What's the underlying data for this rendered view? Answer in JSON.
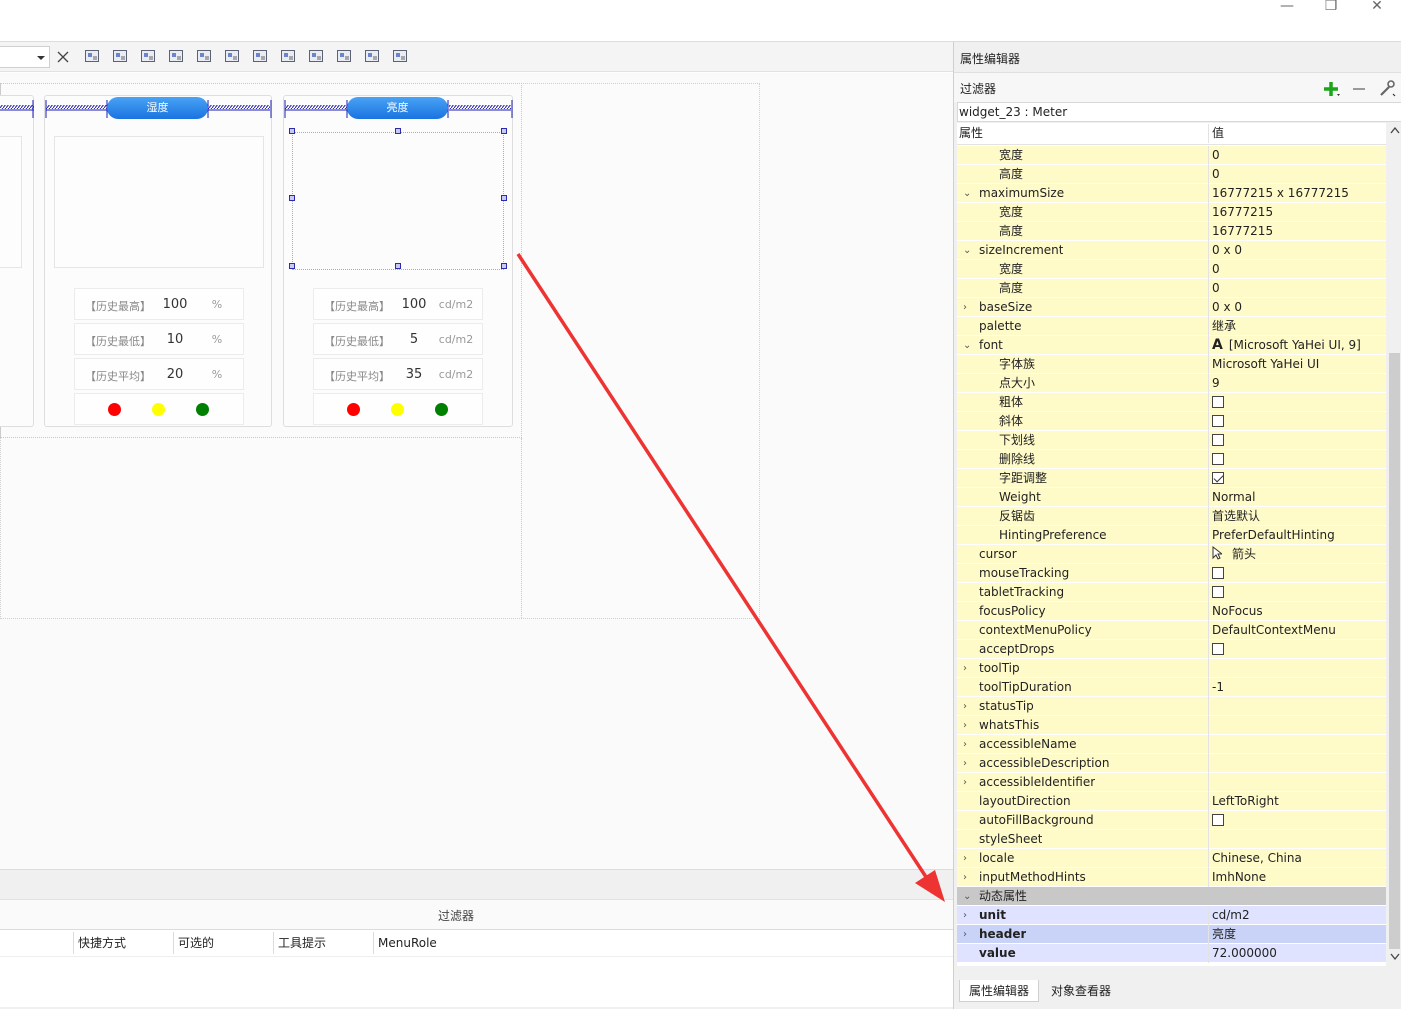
{
  "window": {
    "minimize": "—",
    "restore": "❐",
    "close": "✕"
  },
  "toolbar": {
    "icons": [
      "dropdown-arrow-icon",
      "close-icon",
      "edit-widgets-icon",
      "edit-signals-icon",
      "edit-buddies-icon",
      "edit-tab-order-icon",
      "layout-horizontal-icon",
      "layout-vertical-icon",
      "layout-horizontal-splitter-icon",
      "layout-vertical-splitter-icon",
      "layout-form-icon",
      "layout-grid-icon",
      "break-layout-icon",
      "adjust-size-icon"
    ]
  },
  "canvas": {
    "panels": [
      {
        "header": "湿度",
        "stats": [
          {
            "label": "【历史最高】",
            "value": "100",
            "unit": "%"
          },
          {
            "label": "【历史最低】",
            "value": "10",
            "unit": "%"
          },
          {
            "label": "【历史平均】",
            "value": "20",
            "unit": "%"
          }
        ]
      },
      {
        "header": "亮度",
        "stats": [
          {
            "label": "【历史最高】",
            "value": "100",
            "unit": "cd/m2"
          },
          {
            "label": "【历史最低】",
            "value": "5",
            "unit": "cd/m2"
          },
          {
            "label": "【历史平均】",
            "value": "35",
            "unit": "cd/m2"
          }
        ]
      }
    ],
    "indicator_colors": [
      "#ff0000",
      "#ffff00",
      "#008000"
    ]
  },
  "action_editor": {
    "filter_label": "过滤器",
    "columns": [
      "快捷方式",
      "可选的",
      "工具提示",
      "MenuRole"
    ]
  },
  "property_editor": {
    "title": "属性编辑器",
    "filter_label": "过滤器",
    "object": "widget_23 : Meter",
    "col_property": "属性",
    "col_value": "值",
    "rows": [
      {
        "name": "宽度",
        "value": "0",
        "indent": 2,
        "style": "y"
      },
      {
        "name": "高度",
        "value": "0",
        "indent": 2,
        "style": "y"
      },
      {
        "name": "maximumSize",
        "value": "16777215 x 16777215",
        "indent": 1,
        "style": "y",
        "exp": "down"
      },
      {
        "name": "宽度",
        "value": "16777215",
        "indent": 2,
        "style": "y"
      },
      {
        "name": "高度",
        "value": "16777215",
        "indent": 2,
        "style": "y"
      },
      {
        "name": "sizeIncrement",
        "value": "0 x 0",
        "indent": 1,
        "style": "y",
        "exp": "down"
      },
      {
        "name": "宽度",
        "value": "0",
        "indent": 2,
        "style": "y"
      },
      {
        "name": "高度",
        "value": "0",
        "indent": 2,
        "style": "y"
      },
      {
        "name": "baseSize",
        "value": "0 x 0",
        "indent": 1,
        "style": "y",
        "exp": "right"
      },
      {
        "name": "palette",
        "value": "继承",
        "indent": 1,
        "style": "y"
      },
      {
        "name": "font",
        "value": "[Microsoft YaHei UI, 9]",
        "indent": 1,
        "style": "y",
        "exp": "down",
        "icon": "font-icon"
      },
      {
        "name": "字体族",
        "value": "Microsoft YaHei UI",
        "indent": 2,
        "style": "y"
      },
      {
        "name": "点大小",
        "value": "9",
        "indent": 2,
        "style": "y"
      },
      {
        "name": "粗体",
        "value": "",
        "indent": 2,
        "style": "y",
        "check": false
      },
      {
        "name": "斜体",
        "value": "",
        "indent": 2,
        "style": "y",
        "check": false
      },
      {
        "name": "下划线",
        "value": "",
        "indent": 2,
        "style": "y",
        "check": false
      },
      {
        "name": "删除线",
        "value": "",
        "indent": 2,
        "style": "y",
        "check": false
      },
      {
        "name": "字距调整",
        "value": "",
        "indent": 2,
        "style": "y",
        "check": true
      },
      {
        "name": "Weight",
        "value": "Normal",
        "indent": 2,
        "style": "y"
      },
      {
        "name": "反锯齿",
        "value": "首选默认",
        "indent": 2,
        "style": "y"
      },
      {
        "name": "HintingPreference",
        "value": "PreferDefaultHinting",
        "indent": 2,
        "style": "y"
      },
      {
        "name": "cursor",
        "value": "箭头",
        "indent": 1,
        "style": "y",
        "icon": "arrow-cursor-icon"
      },
      {
        "name": "mouseTracking",
        "value": "",
        "indent": 1,
        "style": "y",
        "check": false
      },
      {
        "name": "tabletTracking",
        "value": "",
        "indent": 1,
        "style": "y",
        "check": false
      },
      {
        "name": "focusPolicy",
        "value": "NoFocus",
        "indent": 1,
        "style": "y"
      },
      {
        "name": "contextMenuPolicy",
        "value": "DefaultContextMenu",
        "indent": 1,
        "style": "y"
      },
      {
        "name": "acceptDrops",
        "value": "",
        "indent": 1,
        "style": "y",
        "check": false
      },
      {
        "name": "toolTip",
        "value": "",
        "indent": 1,
        "style": "y",
        "exp": "right"
      },
      {
        "name": "toolTipDuration",
        "value": "-1",
        "indent": 1,
        "style": "y"
      },
      {
        "name": "statusTip",
        "value": "",
        "indent": 1,
        "style": "y",
        "exp": "right"
      },
      {
        "name": "whatsThis",
        "value": "",
        "indent": 1,
        "style": "y",
        "exp": "right"
      },
      {
        "name": "accessibleName",
        "value": "",
        "indent": 1,
        "style": "y",
        "exp": "right"
      },
      {
        "name": "accessibleDescription",
        "value": "",
        "indent": 1,
        "style": "y",
        "exp": "right"
      },
      {
        "name": "accessibleIdentifier",
        "value": "",
        "indent": 1,
        "style": "y",
        "exp": "right"
      },
      {
        "name": "layoutDirection",
        "value": "LeftToRight",
        "indent": 1,
        "style": "y"
      },
      {
        "name": "autoFillBackground",
        "value": "",
        "indent": 1,
        "style": "y",
        "check": false
      },
      {
        "name": "styleSheet",
        "value": "",
        "indent": 1,
        "style": "y"
      },
      {
        "name": "locale",
        "value": "Chinese, China",
        "indent": 1,
        "style": "y",
        "exp": "right"
      },
      {
        "name": "inputMethodHints",
        "value": "ImhNone",
        "indent": 1,
        "style": "y",
        "exp": "right"
      },
      {
        "name": "动态属性",
        "value": "",
        "indent": 1,
        "style": "grp",
        "exp": "down"
      },
      {
        "name": "unit",
        "value": "cd/m2",
        "indent": 1,
        "style": "dyn",
        "exp": "right",
        "bold": true
      },
      {
        "name": "header",
        "value": "亮度",
        "indent": 1,
        "style": "sel",
        "exp": "right",
        "bold": true
      },
      {
        "name": "value",
        "value": "72.000000",
        "indent": 1,
        "style": "dyn",
        "bold": true
      }
    ],
    "tabs": [
      "属性编辑器",
      "对象查看器"
    ]
  }
}
